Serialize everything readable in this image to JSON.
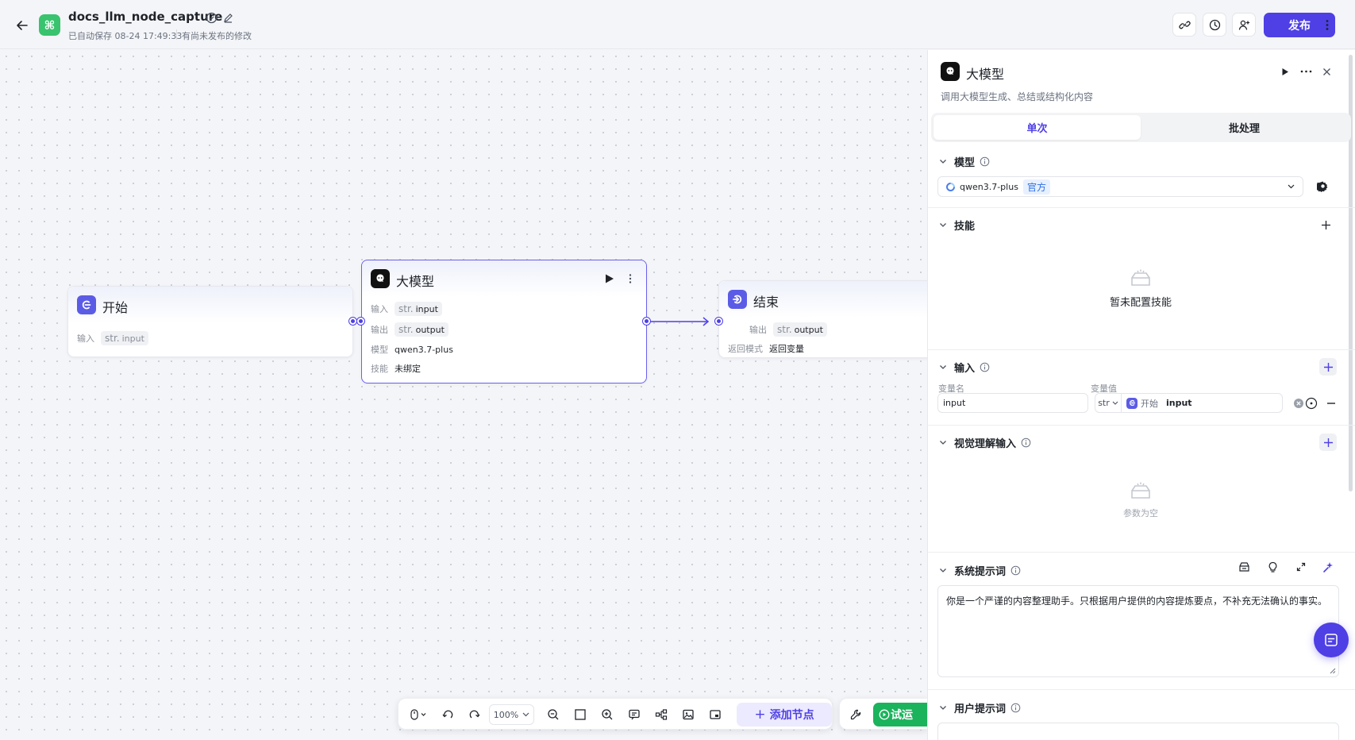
{
  "header": {
    "title": "docs_llm_node_capture",
    "save_status": "已自动保存 08-24 17:49:33",
    "publish_status": "有尚未发布的修改",
    "publish_label": "发布"
  },
  "canvas": {
    "start_node": {
      "title": "开始",
      "input_label": "输入",
      "input_type": "str.",
      "input_name": "input"
    },
    "llm_node": {
      "title": "大模型",
      "input_label": "输入",
      "input_type": "str.",
      "input_name": "input",
      "output_label": "输出",
      "output_type": "str.",
      "output_name": "output",
      "model_label": "模型",
      "model_value": "qwen3.7-plus",
      "skill_label": "技能",
      "skill_value": "未绑定"
    },
    "end_node": {
      "title": "结束",
      "output_label": "输出",
      "output_type": "str.",
      "output_name": "output",
      "return_label": "返回模式",
      "return_value": "返回变量"
    }
  },
  "toolbar": {
    "zoom": "100%",
    "add_node_label": "添加节点",
    "run_label": "试运"
  },
  "panel": {
    "title": "大模型",
    "description": "调用大模型生成、总结或结构化内容",
    "tabs": [
      {
        "label": "单次",
        "active": true
      },
      {
        "label": "批处理",
        "active": false
      }
    ],
    "model_section": {
      "title": "模型",
      "selected": "qwen3.7-plus",
      "badge": "官方"
    },
    "skills_section": {
      "title": "技能",
      "empty_text": "暂未配置技能"
    },
    "input_section": {
      "title": "输入",
      "col_name": "变量名",
      "col_value": "变量值",
      "var_name": "input",
      "var_type": "str",
      "ref_node": "开始",
      "ref_var": "input"
    },
    "vision_section": {
      "title": "视觉理解输入",
      "empty_text": "参数为空"
    },
    "system_prompt_section": {
      "title": "系统提示词",
      "text": "你是一个严谨的内容整理助手。只根据用户提供的内容提炼要点，不补充无法确认的事实。"
    },
    "user_prompt_section": {
      "title": "用户提示词"
    }
  },
  "colors": {
    "accent": "#4e40e5",
    "run_green": "#1bb35c",
    "logo_green": "#39c36e"
  }
}
